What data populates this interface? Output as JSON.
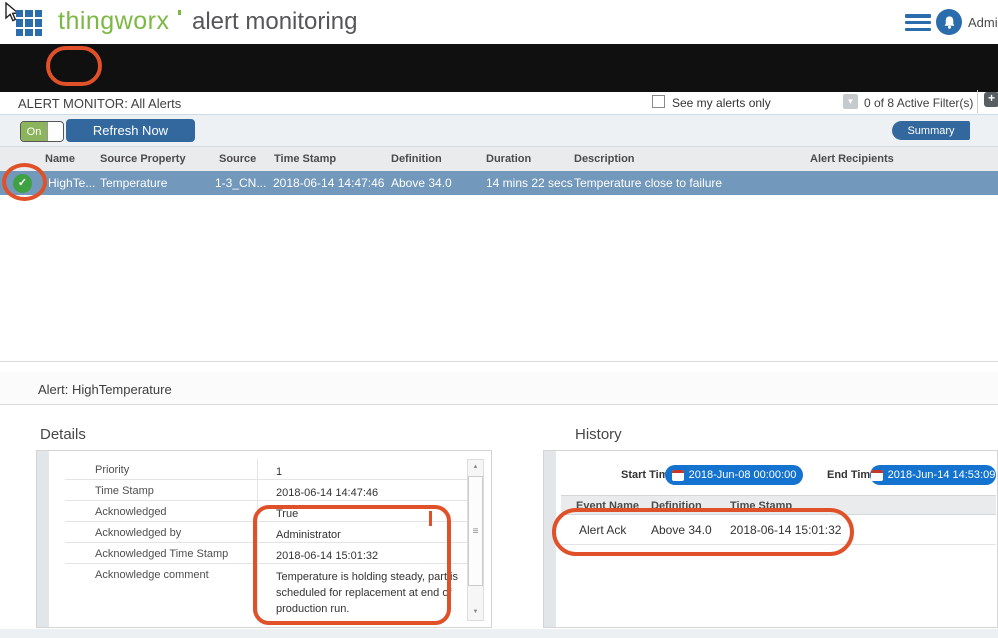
{
  "colors": {
    "brand_green": "#7cb843",
    "brand_blue": "#2b6cac",
    "button_blue": "#32689e",
    "datetime_blue": "#1473cf",
    "selected_row_blue": "#7298bb",
    "badge_green": "#3ea142",
    "toggle_green": "#8cb45c",
    "annotation_orange": "#e0512a"
  },
  "icons": {
    "grid": "app-launcher-grid",
    "menu": "hamburger-menu",
    "bell": "notification-bell",
    "back": "↩",
    "ack": "✓",
    "check": "✓",
    "caret_down": "▾",
    "plus": "+",
    "arrow_up": "▲",
    "arrow_down": "▼",
    "grip": "≡",
    "calendar": "calendar"
  },
  "header": {
    "logo_text": "thingworx",
    "app_title": "alert monitoring",
    "user_name": "Administrator"
  },
  "monitor": {
    "title": "ALERT MONITOR: All Alerts",
    "see_my_alerts_label": "See my alerts only",
    "active_filters_label": "0 of 8 Active Filter(s)"
  },
  "controls": {
    "toggle_on_label": "On",
    "refresh_button_label": "Refresh Now",
    "summary_button_label": "Summary"
  },
  "alerts_table": {
    "columns": [
      "Name",
      "Source Property",
      "Source",
      "Time Stamp",
      "Definition",
      "Duration",
      "Description",
      "Alert Recipients"
    ],
    "selected_row": {
      "name": "HighTe...",
      "source_property": "Temperature",
      "source": "1-3_CN...",
      "time_stamp": "2018-06-14 14:47:46",
      "definition": "Above 34.0",
      "duration": "14 mins 22 secs",
      "description": "Temperature close to failure",
      "alert_recipients": ""
    }
  },
  "alert_panel": {
    "title": "Alert: HighTemperature",
    "details": {
      "heading": "Details",
      "rows": [
        {
          "label": "Priority",
          "value": "1"
        },
        {
          "label": "Time Stamp",
          "value": "2018-06-14 14:47:46"
        },
        {
          "label": "Acknowledged",
          "value": "True"
        },
        {
          "label": "Acknowledged by",
          "value": "Administrator"
        },
        {
          "label": "Acknowledged Time Stamp",
          "value": "2018-06-14 15:01:32"
        },
        {
          "label": "Acknowledge comment",
          "value": "Temperature is holding steady, part is scheduled for replacement at end of production run."
        }
      ]
    },
    "history": {
      "heading": "History",
      "start_time_label": "Start Time",
      "start_time_value": "2018-Jun-08 00:00:00",
      "end_time_label": "End Time",
      "end_time_value": "2018-Jun-14 14:53:09",
      "columns": [
        "Event Name",
        "Definition",
        "Time Stamp"
      ],
      "row": {
        "event_name": "Alert Ack",
        "definition": "Above 34.0",
        "time_stamp": "2018-06-14 15:01:32"
      }
    }
  }
}
